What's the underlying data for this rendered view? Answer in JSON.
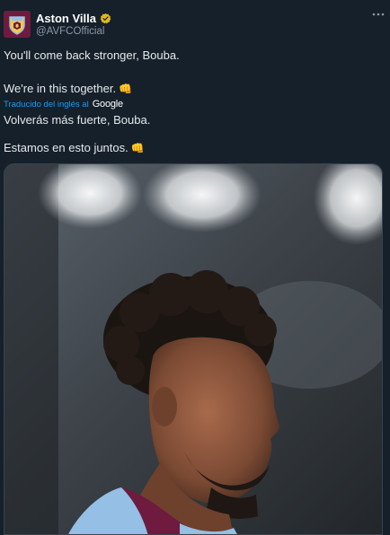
{
  "tweet": {
    "author": {
      "display_name": "Aston Villa",
      "handle": "@AVFCOfficial",
      "verified_icon": "verified-badge-gold"
    },
    "more_icon": "more-options-icon",
    "original_text": {
      "line1": "You'll come back stronger, Bouba.",
      "line2": "We're in this together."
    },
    "translation": {
      "label": "Traducido del inglés al",
      "provider": "Google"
    },
    "translated_text": {
      "line1": "Volverás más fuerte, Bouba.",
      "line2": "Estamos en esto juntos."
    },
    "emoji": "👊",
    "media": {
      "kind": "photo",
      "subject": "player-portrait"
    },
    "colors": {
      "background": "#15202b",
      "text": "#e7e9ea",
      "secondary_text": "#8b98a5",
      "link": "#1d9bf0",
      "verified_gold": "#e2b719",
      "club_claret": "#6e1b3f",
      "club_blue": "#95bfe5"
    }
  }
}
